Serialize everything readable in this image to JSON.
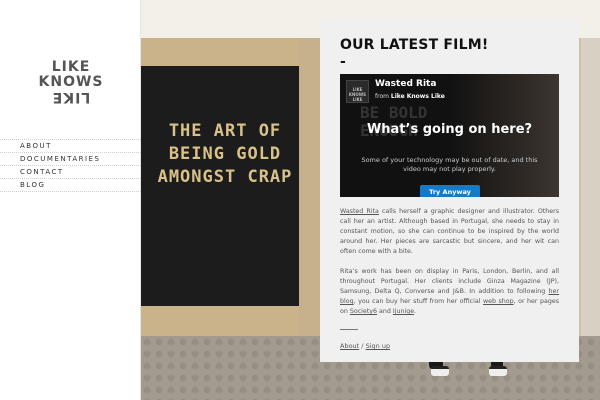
{
  "logo": {
    "line1": "LIKE",
    "line2": "KNOWS",
    "line3": "LIKE"
  },
  "nav": [
    {
      "label": "ABOUT"
    },
    {
      "label": "DOCUMENTARIES"
    },
    {
      "label": "CONTACT"
    },
    {
      "label": "BLOG"
    }
  ],
  "photo": {
    "board_text": "THE ART OF BEING GOLD AMONGST CRAP"
  },
  "panel": {
    "title": "OUR LATEST FILM!",
    "dash": "-",
    "video": {
      "channel_thumb": "LIKE KNOWS LIKE",
      "title": "Wasted Rita",
      "from_prefix": "from",
      "from_channel": "Like Knows Like",
      "bg_letters": "BE BOLD\nENOUGH",
      "headline": "What’s going on here?",
      "subtext": "Some of your technology may be out of date, and this video may not play properly.",
      "button": "Try Anyway"
    },
    "para1": {
      "link": "Wasted Rita",
      "text": " calls herself a graphic designer and illustrator. Others call her an artist. Although based in Portugal, she needs to stay in constant motion, so she can continue to be inspired by the world around her. Her pieces are sarcastic but sincere, and her wit can often come with a bite."
    },
    "para2": {
      "t1": "Rita’s work has been on display in Paris, London, Berlin, and all throughout Portugal. Her clients include Ginza Magazine (JP), Samsung, Delta Q, Converse and J&B. In addition to following ",
      "link1": "her blog",
      "t2": ", you can buy her stuff from her official ",
      "link2": "web shop",
      "t3": ", or her pages on ",
      "link3": "Society6",
      "t4": " and ",
      "link4": "Ijunige",
      "t5": "."
    },
    "footer": {
      "about": "About",
      "sep": "/",
      "signup": "Sign up"
    }
  },
  "colors": {
    "accent_button": "#167ac6",
    "panel_bg": "#f0f0f0"
  }
}
